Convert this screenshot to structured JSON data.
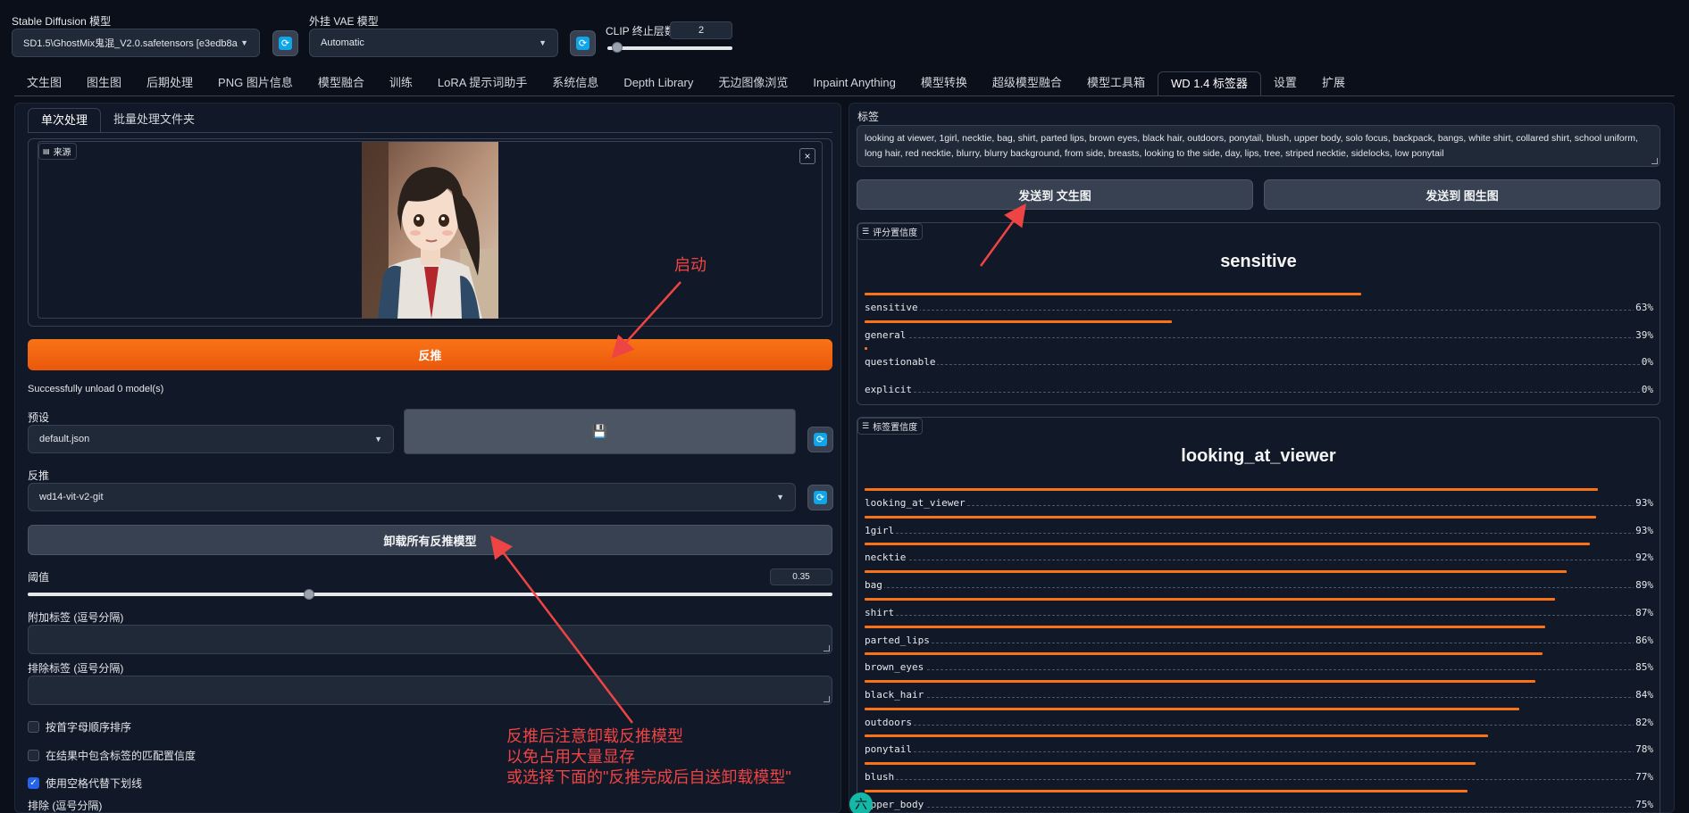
{
  "top": {
    "sd_model_label": "Stable Diffusion 模型",
    "sd_model_value": "SD1.5\\GhostMix鬼混_V2.0.safetensors [e3edb8a",
    "vae_label": "外挂 VAE 模型",
    "vae_value": "Automatic",
    "clip_label": "CLIP 终止层数",
    "clip_value": "2",
    "clip_level": 0.08
  },
  "tabs": [
    "文生图",
    "图生图",
    "后期处理",
    "PNG 图片信息",
    "模型融合",
    "训练",
    "LoRA 提示词助手",
    "系统信息",
    "Depth Library",
    "无边图像浏览",
    "Inpaint Anything",
    "模型转换",
    "超级模型融合",
    "模型工具箱",
    "WD 1.4 标签器",
    "设置",
    "扩展"
  ],
  "active_tab": "WD 1.4 标签器",
  "left": {
    "subtab_single": "单次处理",
    "subtab_batch": "批量处理文件夹",
    "source_label": "来源",
    "close_glyph": "×",
    "interrogate_button": "反推",
    "status": "Successfully unload 0 model(s)",
    "preset_label": "预设",
    "preset_value": "default.json",
    "save_glyph": "💾",
    "interrogator_label": "反推",
    "interrogator_value": "wd14-vit-v2-git",
    "unload_button": "卸载所有反推模型",
    "threshold_label": "阈值",
    "threshold_value": "0.35",
    "threshold_level": 0.35,
    "additional_tags_label": "附加标签 (逗号分隔)",
    "exclude_tags_label": "排除标签 (逗号分隔)",
    "check_sort": "按首字母顺序排序",
    "check_confidence": "在结果中包含标签的匹配置信度",
    "check_underscore": "使用空格代替下划线",
    "check_mark": "✓",
    "exclude_label_bottom": "排除 (逗号分隔)"
  },
  "right": {
    "tags_label": "标签",
    "tags_text": "looking at viewer, 1girl, necktie, bag, shirt, parted lips, brown eyes, black hair, outdoors, ponytail, blush, upper body, solo focus, backpack, bangs, white shirt, collared shirt, school uniform, long hair, red necktie, blurry, blurry background, from side, breasts, looking to the side, day, lips, tree, striped necktie, sidelocks, low ponytail",
    "send_txt2img": "发送到 文生图",
    "send_img2img": "发送到 图生图",
    "rating_label": "评分置信度",
    "rating_top": "sensitive",
    "ratings": [
      {
        "name": "sensitive",
        "value": 0.63,
        "pct": "63%"
      },
      {
        "name": "general",
        "value": 0.39,
        "pct": "39%"
      },
      {
        "name": "questionable",
        "value": 0.003,
        "pct": "0%"
      },
      {
        "name": "explicit",
        "value": 0.0,
        "pct": "0%"
      }
    ],
    "tag_conf_label": "标签置信度",
    "tag_top": "looking_at_viewer",
    "tag_confidences": [
      {
        "name": "looking_at_viewer",
        "value": 0.93,
        "pct": "93%"
      },
      {
        "name": "1girl",
        "value": 0.928,
        "pct": "93%"
      },
      {
        "name": "necktie",
        "value": 0.92,
        "pct": "92%"
      },
      {
        "name": "bag",
        "value": 0.89,
        "pct": "89%"
      },
      {
        "name": "shirt",
        "value": 0.875,
        "pct": "87%"
      },
      {
        "name": "parted_lips",
        "value": 0.863,
        "pct": "86%"
      },
      {
        "name": "brown_eyes",
        "value": 0.86,
        "pct": "85%"
      },
      {
        "name": "black_hair",
        "value": 0.85,
        "pct": "84%"
      },
      {
        "name": "outdoors",
        "value": 0.83,
        "pct": "82%"
      },
      {
        "name": "ponytail",
        "value": 0.79,
        "pct": "78%"
      },
      {
        "name": "blush",
        "value": 0.775,
        "pct": "77%"
      },
      {
        "name": "upper_body",
        "value": 0.765,
        "pct": "75%"
      }
    ]
  },
  "annotations": {
    "start": "启动",
    "note_line1": "反推后注意卸载反推模型",
    "note_line2": "以免占用大量显存",
    "note_line3": "或选择下面的\"反推完成后自送卸载模型\"",
    "accent": "#ef4444"
  },
  "colors": {
    "accent": "#f97316",
    "background": "#0b0f19",
    "panel": "#111827"
  },
  "float_badge": "六"
}
